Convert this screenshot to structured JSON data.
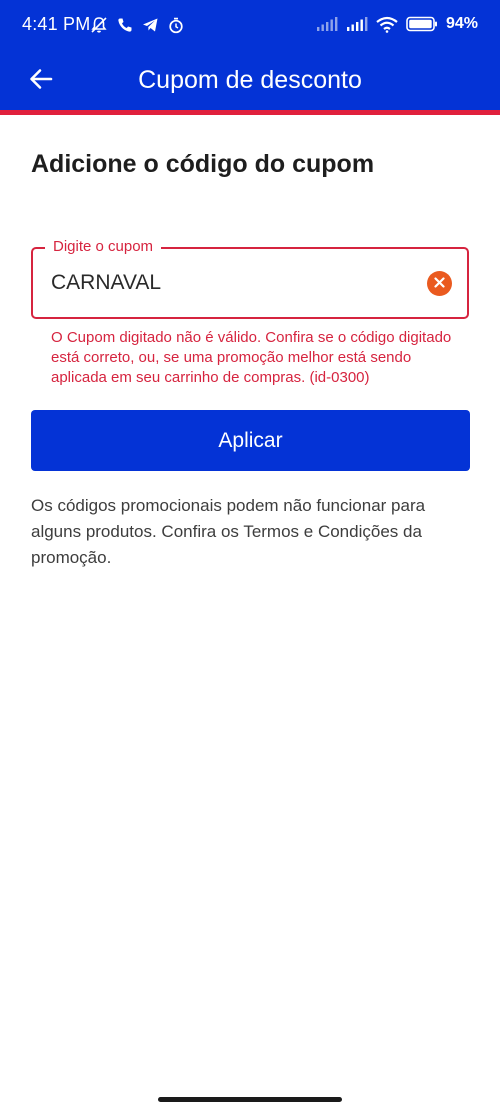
{
  "status_bar": {
    "time": "4:41 PM",
    "battery_percent": "94",
    "icons_left": [
      "muted-bell-icon",
      "phone-icon",
      "telegram-icon",
      "alarm-icon"
    ],
    "icons_right": [
      "signal-icon",
      "signal-icon",
      "wifi-icon",
      "battery-icon"
    ]
  },
  "app_bar": {
    "title": "Cupom de desconto",
    "background_color": "#0433d6",
    "accent_color": "#e0203c"
  },
  "main": {
    "heading": "Adicione o código do cupom",
    "coupon_field": {
      "label": "Digite o cupom",
      "value": "CARNAVAL"
    },
    "error_message": "O Cupom digitado não é válido. Confira se o código digitado está correto, ou, se uma promoção melhor está sendo aplicada em seu carrinho de compras. (id-0300)",
    "apply_button_label": "Aplicar",
    "info_text": "Os códigos promocionais podem não funcionar para alguns produtos. Confira os Termos e Condições da promoção."
  },
  "colors": {
    "primary": "#0433d6",
    "error": "#d6243f",
    "clear_icon": "#ea5a1f"
  }
}
